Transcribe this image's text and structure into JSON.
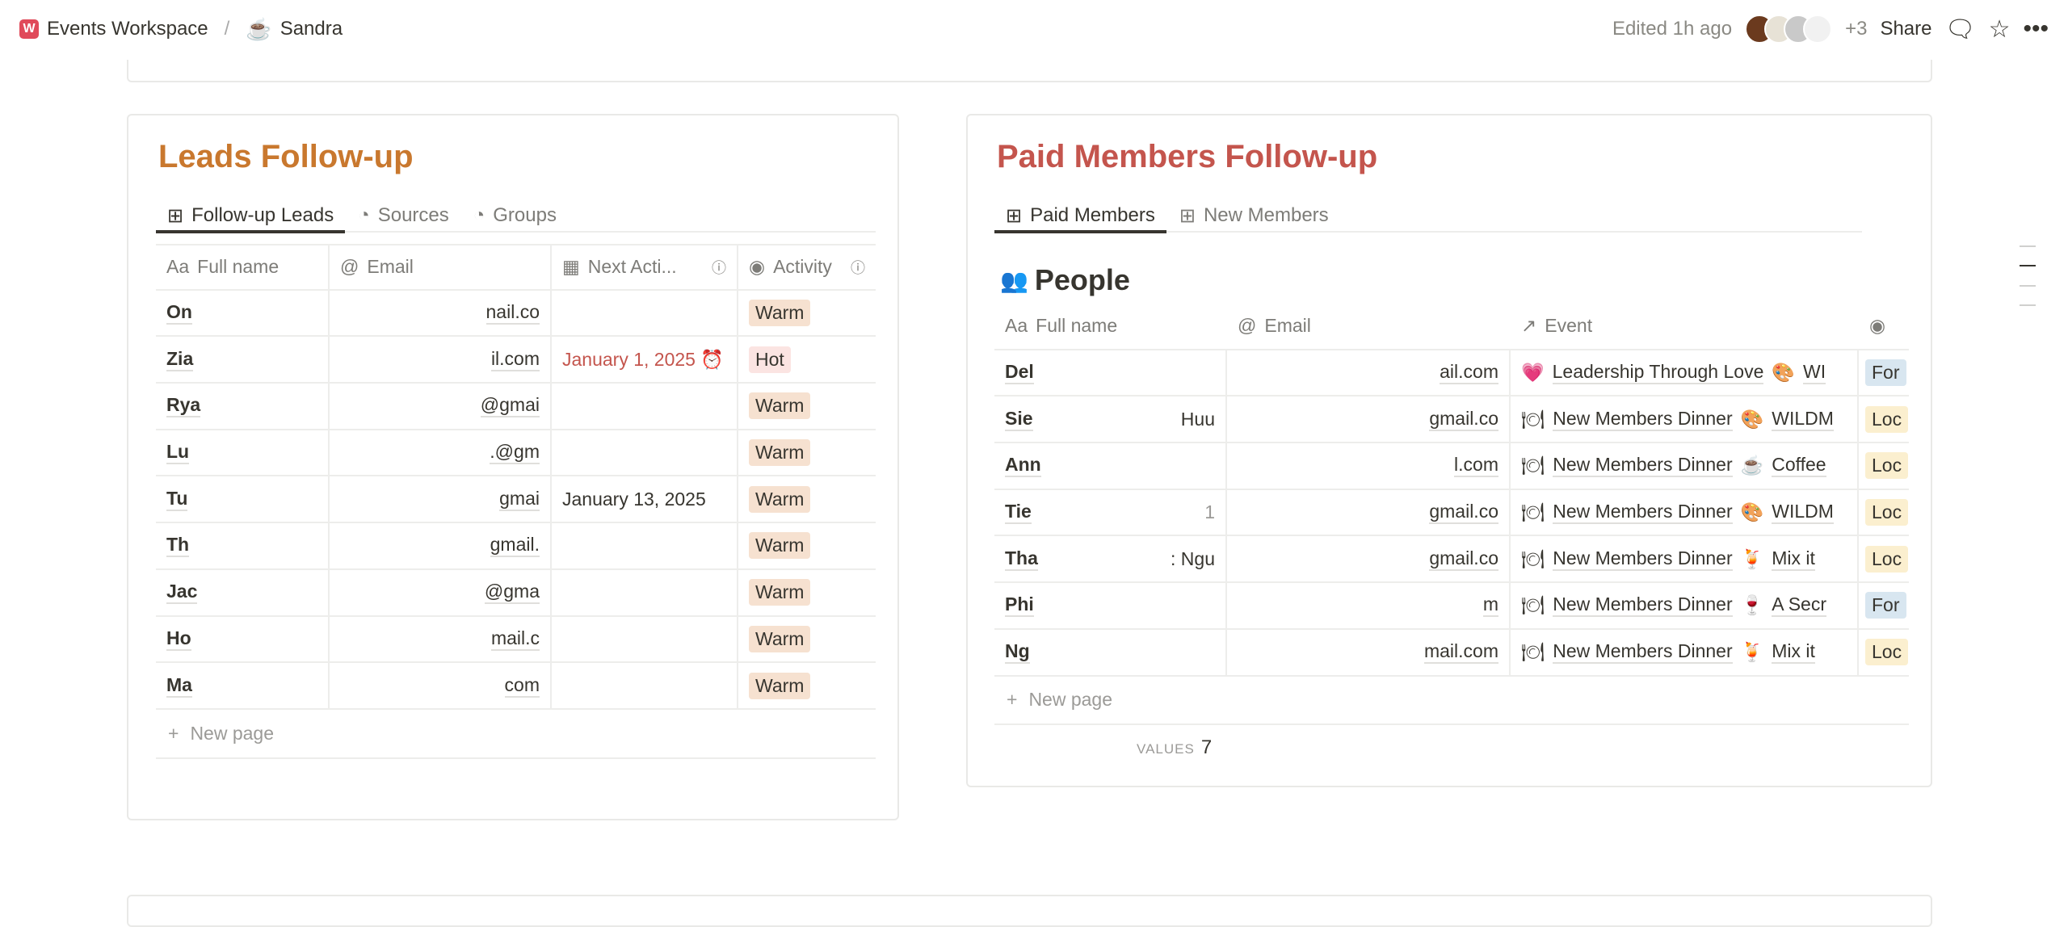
{
  "topbar": {
    "workspace": "Events Workspace",
    "page": "Sandra",
    "edited": "Edited 1h ago",
    "extra_count": "+3",
    "share": "Share"
  },
  "leads": {
    "title": "Leads Follow-up",
    "title_color": "#c9782e",
    "tabs": [
      {
        "label": "Follow-up Leads",
        "icon": "table-icon"
      },
      {
        "label": "Sources",
        "icon": "chart-icon"
      },
      {
        "label": "Groups",
        "icon": "chart-icon"
      }
    ],
    "columns": [
      "Full name",
      "Email",
      "Next Acti...",
      "Activity"
    ],
    "rows": [
      {
        "name": "On",
        "email": "nail.co",
        "date": "",
        "activity": "Warm"
      },
      {
        "name": "Zia",
        "email": "il.com",
        "date": "January 1, 2025",
        "activity": "Hot"
      },
      {
        "name": "Rya",
        "email": "@gmai",
        "date": "",
        "activity": "Warm"
      },
      {
        "name": "Lu",
        "email": ".@gm",
        "date": "",
        "activity": "Warm"
      },
      {
        "name": "Tu",
        "email": "gmai",
        "date": "January 13, 2025",
        "activity": "Warm"
      },
      {
        "name": "Th",
        "email": "gmail.",
        "date": "",
        "activity": "Warm"
      },
      {
        "name": "Jac",
        "email": "@gma",
        "date": "",
        "activity": "Warm"
      },
      {
        "name": "Ho",
        "email": "mail.c",
        "date": "",
        "activity": "Warm"
      },
      {
        "name": "Ma",
        "email": "com",
        "date": "",
        "activity": "Warm"
      }
    ],
    "new_page": "New page"
  },
  "paid": {
    "title": "Paid Members Follow-up",
    "title_color": "#c4554d",
    "tabs": [
      {
        "label": "Paid Members",
        "icon": "table-icon"
      },
      {
        "label": "New Members",
        "icon": "table-icon"
      }
    ],
    "db_title": "People",
    "columns": [
      "Full name",
      "Email",
      "Event",
      ""
    ],
    "rows": [
      {
        "name": "Del",
        "name2": "",
        "email": "ail.com",
        "event": "Leadership Through Love",
        "event_icon": "💗",
        "event2": "WI",
        "event2_icon": "🎨",
        "tag": "For",
        "tag_type": "for"
      },
      {
        "name": "Sie",
        "name2": "Huu",
        "email": "gmail.co",
        "event": "New Members Dinner",
        "event_icon": "🍽",
        "event2": "WILDM",
        "event2_icon": "🎨",
        "tag": "Loc",
        "tag_type": "loc"
      },
      {
        "name": "Ann",
        "name2": "",
        "email": "l.com",
        "event": "New Members Dinner",
        "event_icon": "🍽",
        "event2": "Coffee",
        "event2_icon": "☕",
        "tag": "Loc",
        "tag_type": "loc"
      },
      {
        "name": "Tie",
        "name2": "1",
        "email": "gmail.co",
        "event": "New Members Dinner",
        "event_icon": "🍽",
        "event2": "WILDM",
        "event2_icon": "🎨",
        "tag": "Loc",
        "tag_type": "loc"
      },
      {
        "name": "Tha",
        "name2": ": Ngu",
        "email": "gmail.co",
        "event": "New Members Dinner",
        "event_icon": "🍽",
        "event2": "Mix it",
        "event2_icon": "🍹",
        "tag": "Loc",
        "tag_type": "loc"
      },
      {
        "name": "Phi",
        "name2": "",
        "email": "m",
        "event": "New Members Dinner",
        "event_icon": "🍽",
        "event2": "A Secr",
        "event2_icon": "🍷",
        "tag": "For",
        "tag_type": "for"
      },
      {
        "name": "Ng",
        "name2": "",
        "email": "mail.com",
        "event": "New Members Dinner",
        "event_icon": "🍽",
        "event2": "Mix it",
        "event2_icon": "🍹",
        "tag": "Loc",
        "tag_type": "loc"
      }
    ],
    "new_page": "New page",
    "values_label": "VALUES",
    "values_count": "7"
  }
}
